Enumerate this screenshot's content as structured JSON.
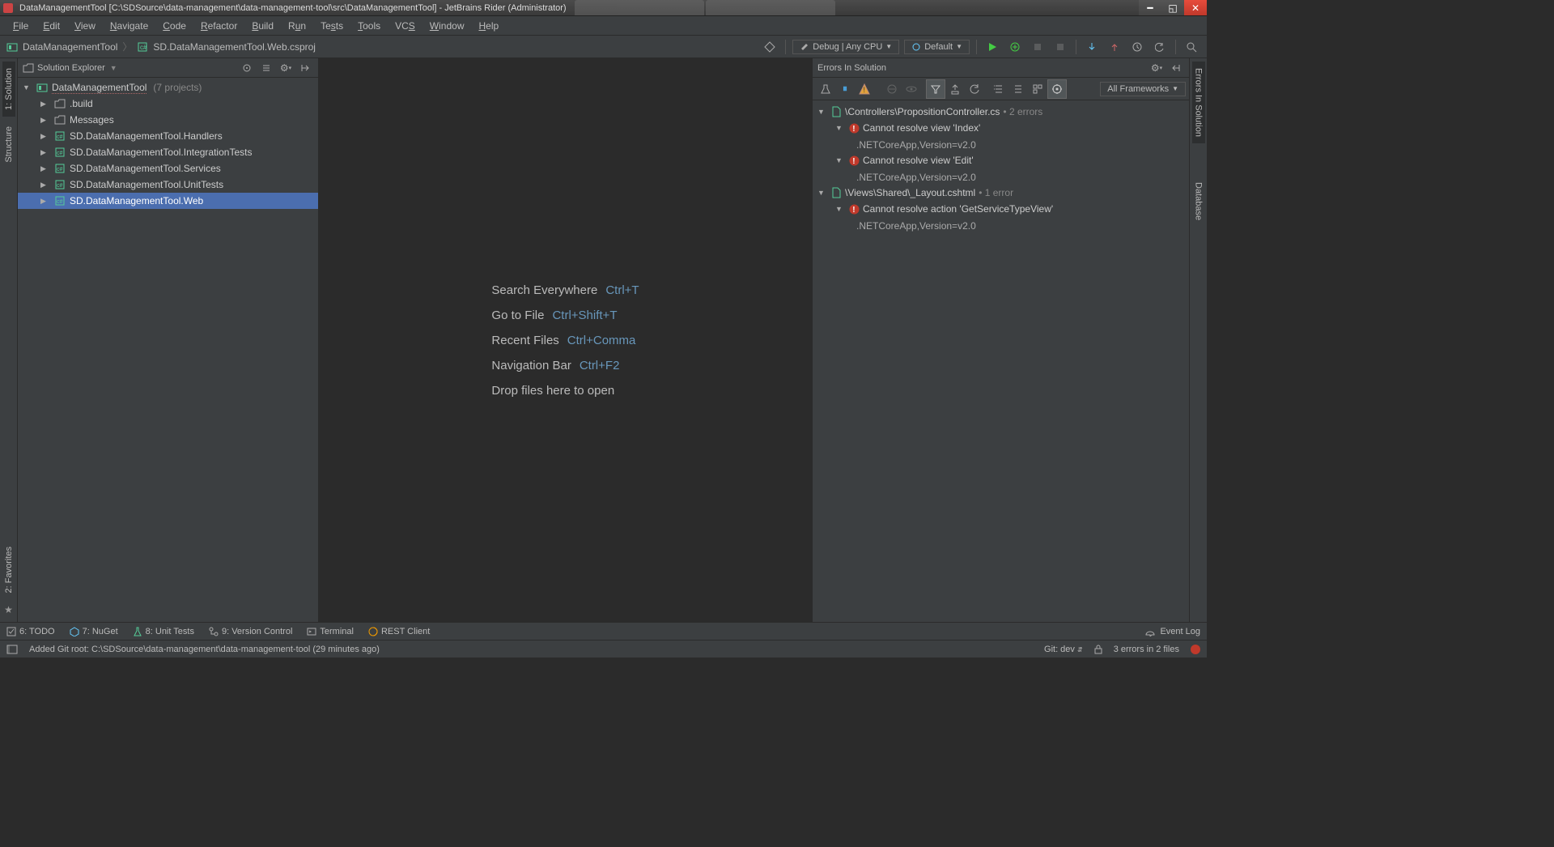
{
  "titlebar": {
    "title": "DataManagementTool [C:\\SDSource\\data-management\\data-management-tool\\src\\DataManagementTool] - JetBrains Rider (Administrator)"
  },
  "menu": [
    "File",
    "Edit",
    "View",
    "Navigate",
    "Code",
    "Refactor",
    "Build",
    "Run",
    "Tests",
    "Tools",
    "VCS",
    "Window",
    "Help"
  ],
  "breadcrumb": {
    "root": "DataManagementTool",
    "file": "SD.DataManagementTool.Web.csproj"
  },
  "runconfig": {
    "config": "Debug | Any CPU",
    "target": "Default"
  },
  "leftTabs": {
    "solution": "1: Solution",
    "structure": "Structure",
    "favorites": "2: Favorites"
  },
  "rightTabs": {
    "errors": "Errors In Solution",
    "database": "Database"
  },
  "solutionPanel": {
    "title": "Solution Explorer",
    "root": {
      "name": "DataManagementTool",
      "meta": "(7 projects)"
    },
    "items": [
      {
        "name": ".build",
        "icon": "folder"
      },
      {
        "name": "Messages",
        "icon": "folder"
      },
      {
        "name": "SD.DataManagementTool.Handlers",
        "icon": "csproj"
      },
      {
        "name": "SD.DataManagementTool.IntegrationTests",
        "icon": "csproj"
      },
      {
        "name": "SD.DataManagementTool.Services",
        "icon": "csproj"
      },
      {
        "name": "SD.DataManagementTool.UnitTests",
        "icon": "csproj"
      },
      {
        "name": "SD.DataManagementTool.Web",
        "icon": "csproj",
        "selected": true
      }
    ]
  },
  "editorHints": [
    {
      "label": "Search Everywhere",
      "shortcut": "Ctrl+T"
    },
    {
      "label": "Go to File",
      "shortcut": "Ctrl+Shift+T"
    },
    {
      "label": "Recent Files",
      "shortcut": "Ctrl+Comma"
    },
    {
      "label": "Navigation Bar",
      "shortcut": "Ctrl+F2"
    },
    {
      "label": "Drop files here to open",
      "shortcut": ""
    }
  ],
  "errorsPanel": {
    "title": "Errors In Solution",
    "frameworkFilter": "All Frameworks",
    "files": [
      {
        "path": "<SD.DataManagementTool.Web>\\Controllers\\PropositionController.cs",
        "count": "2 errors",
        "errors": [
          {
            "msg": "Cannot resolve view 'Index'",
            "framework": ".NETCoreApp,Version=v2.0"
          },
          {
            "msg": "Cannot resolve view 'Edit'",
            "framework": ".NETCoreApp,Version=v2.0"
          }
        ]
      },
      {
        "path": "<SD.DataManagementTool.Web>\\Views\\Shared\\_Layout.cshtml",
        "count": "1 error",
        "errors": [
          {
            "msg": "Cannot resolve action 'GetServiceTypeView'",
            "framework": ".NETCoreApp,Version=v2.0"
          }
        ]
      }
    ]
  },
  "bottomTools": {
    "todo": "6: TODO",
    "nuget": "7: NuGet",
    "unit": "8: Unit Tests",
    "vcs": "9: Version Control",
    "terminal": "Terminal",
    "rest": "REST Client",
    "eventlog": "Event Log"
  },
  "statusbar": {
    "msg": "Added Git root: C:\\SDSource\\data-management\\data-management-tool (29 minutes ago)",
    "git": "Git: dev",
    "errors": "3 errors in 2 files"
  }
}
